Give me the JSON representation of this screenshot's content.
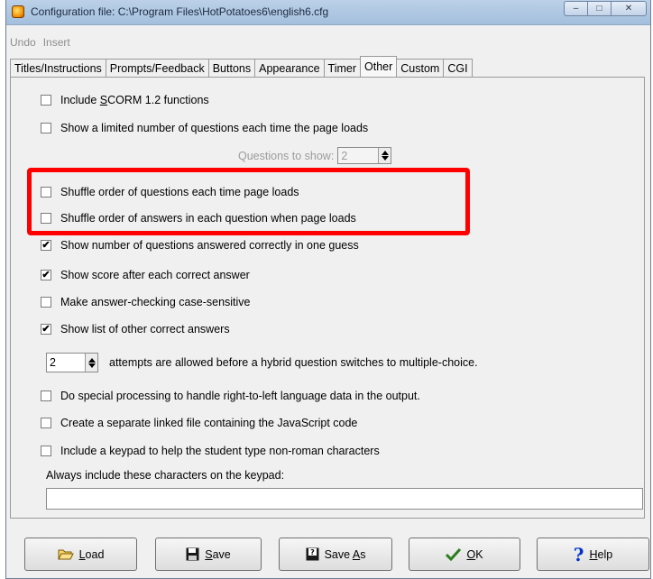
{
  "window": {
    "title": "Configuration file: C:\\Program Files\\HotPotatoes6\\english6.cfg",
    "controls": {
      "minimize": "–",
      "maximize": "□",
      "close": "✕"
    }
  },
  "menu": [
    "Undo",
    "Insert"
  ],
  "tabs": [
    {
      "label": "Titles/Instructions",
      "active": false
    },
    {
      "label": "Prompts/Feedback",
      "active": false
    },
    {
      "label": "Buttons",
      "active": false
    },
    {
      "label": "Appearance",
      "active": false
    },
    {
      "label": "Timer",
      "active": false
    },
    {
      "label": "Other",
      "active": true
    },
    {
      "label": "Custom",
      "active": false
    },
    {
      "label": "CGI",
      "active": false
    }
  ],
  "options": {
    "scorm": {
      "pre": "Include ",
      "accel": "S",
      "post": "CORM 1.2 functions",
      "checked": false
    },
    "limited": {
      "label": "Show a limited number of questions each time the page loads",
      "checked": false
    },
    "shuffle_questions": {
      "label": "Shuffle order of questions each time page loads",
      "checked": false
    },
    "shuffle_answers": {
      "label": "Shuffle order of answers in each question when page loads",
      "checked": false
    },
    "show_one_guess": {
      "label": "Show number of questions answered correctly in one guess",
      "checked": true
    },
    "show_score": {
      "label": "Show score after each correct answer",
      "checked": true
    },
    "case_sensitive": {
      "label": "Make answer-checking case-sensitive",
      "checked": false
    },
    "show_other": {
      "label": "Show list of other correct answers",
      "checked": true
    },
    "rtl": {
      "label": "Do special processing to handle right-to-left language data in the output.",
      "checked": false
    },
    "separate_js": {
      "label": "Create a separate linked file containing the JavaScript code",
      "checked": false
    },
    "keypad": {
      "label": "Include a keypad to help the student type non-roman characters",
      "checked": false
    }
  },
  "questions_to_show": {
    "label": "Questions to show:",
    "value": "2"
  },
  "attempts": {
    "value": "2",
    "label": "attempts are allowed before a hybrid question switches to multiple-choice."
  },
  "keypad_chars": {
    "label": "Always include these characters on the keypad:",
    "value": ""
  },
  "highlight": {
    "color": "#ff0000"
  },
  "buttons": {
    "load": {
      "accel": "L",
      "rest": "oad",
      "icon": "folder-open-icon"
    },
    "save": {
      "accel": "S",
      "rest": "ave",
      "icon": "floppy-disk-icon"
    },
    "save_as": {
      "pre": "Save ",
      "accel": "A",
      "rest": "s",
      "icon": "floppy-disk-question-icon"
    },
    "ok": {
      "accel": "O",
      "rest": "K",
      "icon": "checkmark-icon"
    },
    "help": {
      "accel": "H",
      "rest": "elp",
      "icon": "question-mark-icon"
    }
  }
}
